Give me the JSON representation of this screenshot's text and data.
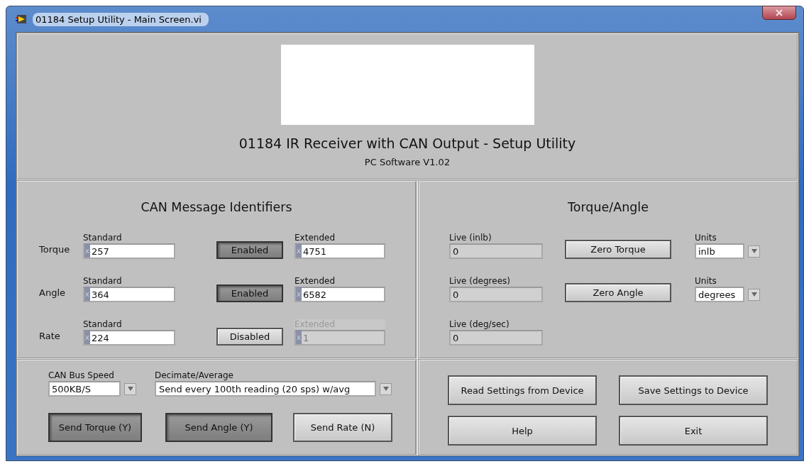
{
  "window": {
    "title": "01184 Setup Utility - Main Screen.vi"
  },
  "header": {
    "title": "01184 IR Receiver with CAN Output - Setup Utility",
    "subtitle": "PC Software V1.02"
  },
  "identifiers": {
    "title": "CAN Message Identifiers",
    "rows": [
      {
        "label": "Torque",
        "standard_label": "Standard",
        "standard_radix": "x",
        "standard": "257",
        "toggle": "Enabled",
        "on": true,
        "extended_label": "Extended",
        "extended_radix": "x",
        "extended": "4751",
        "disabled": false
      },
      {
        "label": "Angle",
        "standard_label": "Standard",
        "standard_radix": "x",
        "standard": "364",
        "toggle": "Enabled",
        "on": true,
        "extended_label": "Extended",
        "extended_radix": "x",
        "extended": "6582",
        "disabled": false
      },
      {
        "label": "Rate",
        "standard_label": "Standard",
        "standard_radix": "x",
        "standard": "224",
        "toggle": "Disabled",
        "on": false,
        "extended_label": "Extended",
        "extended_radix": "x",
        "extended": "1",
        "disabled": true
      }
    ]
  },
  "torque_angle": {
    "title": "Torque/Angle",
    "rows": [
      {
        "live_label": "Live (inlb)",
        "live": "0",
        "button": "Zero Torque",
        "units_label": "Units",
        "units": "inlb"
      },
      {
        "live_label": "Live (degrees)",
        "live": "0",
        "button": "Zero Angle",
        "units_label": "Units",
        "units": "degrees"
      },
      {
        "live_label": "Live (deg/sec)",
        "live": "0"
      }
    ]
  },
  "bus": {
    "speed_label": "CAN Bus Speed",
    "speed": "500KB/S",
    "decimate_label": "Decimate/Average",
    "decimate": "Send every 100th reading (20 sps) w/avg",
    "send_buttons": [
      {
        "label": "Send Torque (Y)",
        "on": true
      },
      {
        "label": "Send Angle (Y)",
        "on": true
      },
      {
        "label": "Send Rate (N)",
        "on": false
      }
    ]
  },
  "actions": [
    "Read Settings from Device",
    "Save Settings to Device",
    "Help",
    "Exit"
  ]
}
